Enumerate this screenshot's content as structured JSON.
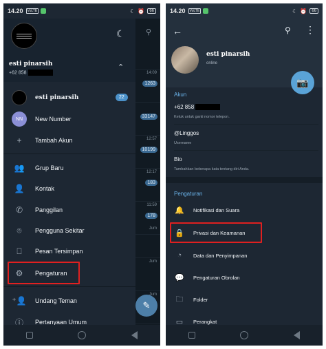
{
  "status_bar": {
    "time": "14.20",
    "badge_left": "VoLTE",
    "battery": "66"
  },
  "left": {
    "chat_list": {
      "rows": [
        {
          "time": "",
          "count": ""
        },
        {
          "time": "14:09",
          "count": "1263"
        },
        {
          "time": "",
          "count": "33147"
        },
        {
          "time": "12:57",
          "count": "10199"
        },
        {
          "time": "12:17",
          "count": "183"
        },
        {
          "time": "11:59",
          "count": "178"
        },
        {
          "time": "Jum",
          "count": ""
        },
        {
          "time": "Jum",
          "count": ""
        },
        {
          "time": "Jum",
          "count": ""
        }
      ]
    },
    "drawer": {
      "name": "esti pinarsih",
      "phone_prefix": "+62 858",
      "accounts": [
        {
          "name": "esti pinarsih",
          "badge": "22"
        },
        {
          "name": "New Number",
          "initials": "NN"
        },
        {
          "name": "Tambah Akun"
        }
      ],
      "menu": [
        {
          "label": "Grup Baru",
          "icon": "group-icon"
        },
        {
          "label": "Kontak",
          "icon": "contact-icon"
        },
        {
          "label": "Panggilan",
          "icon": "phone-icon"
        },
        {
          "label": "Pengguna Sekitar",
          "icon": "nearby-icon"
        },
        {
          "label": "Pesan Tersimpan",
          "icon": "bookmark-icon"
        },
        {
          "label": "Pengaturan",
          "icon": "gear-icon"
        },
        {
          "label": "Undang Teman",
          "icon": "add-person-icon"
        },
        {
          "label": "Pertanyaan Umum",
          "icon": "question-icon"
        }
      ]
    }
  },
  "right": {
    "profile": {
      "name": "esti pinarsih",
      "status": "online"
    },
    "account_section": {
      "title": "Akun",
      "phone_prefix": "+62 858",
      "phone_hint": "Ketuk untuk ganti nomor telepon.",
      "username": "@Linggos",
      "username_label": "Username",
      "bio": "Bio",
      "bio_hint": "Tambahkan beberapa kata tentang diri Anda."
    },
    "settings_section": {
      "title": "Pengaturan",
      "items": [
        {
          "label": "Notifikasi dan Suara",
          "icon": "bell-icon"
        },
        {
          "label": "Privasi dan Keamanan",
          "icon": "lock-icon"
        },
        {
          "label": "Data dan Penyimpanan",
          "icon": "pie-chart-icon"
        },
        {
          "label": "Pengaturan Obrolan",
          "icon": "chat-bubble-icon"
        },
        {
          "label": "Folder",
          "icon": "folder-icon"
        },
        {
          "label": "Perangkat",
          "icon": "device-icon"
        }
      ]
    }
  },
  "colors": {
    "highlight": "#e02020",
    "accent": "#6ab2e8",
    "badge": "#4b91c9"
  }
}
